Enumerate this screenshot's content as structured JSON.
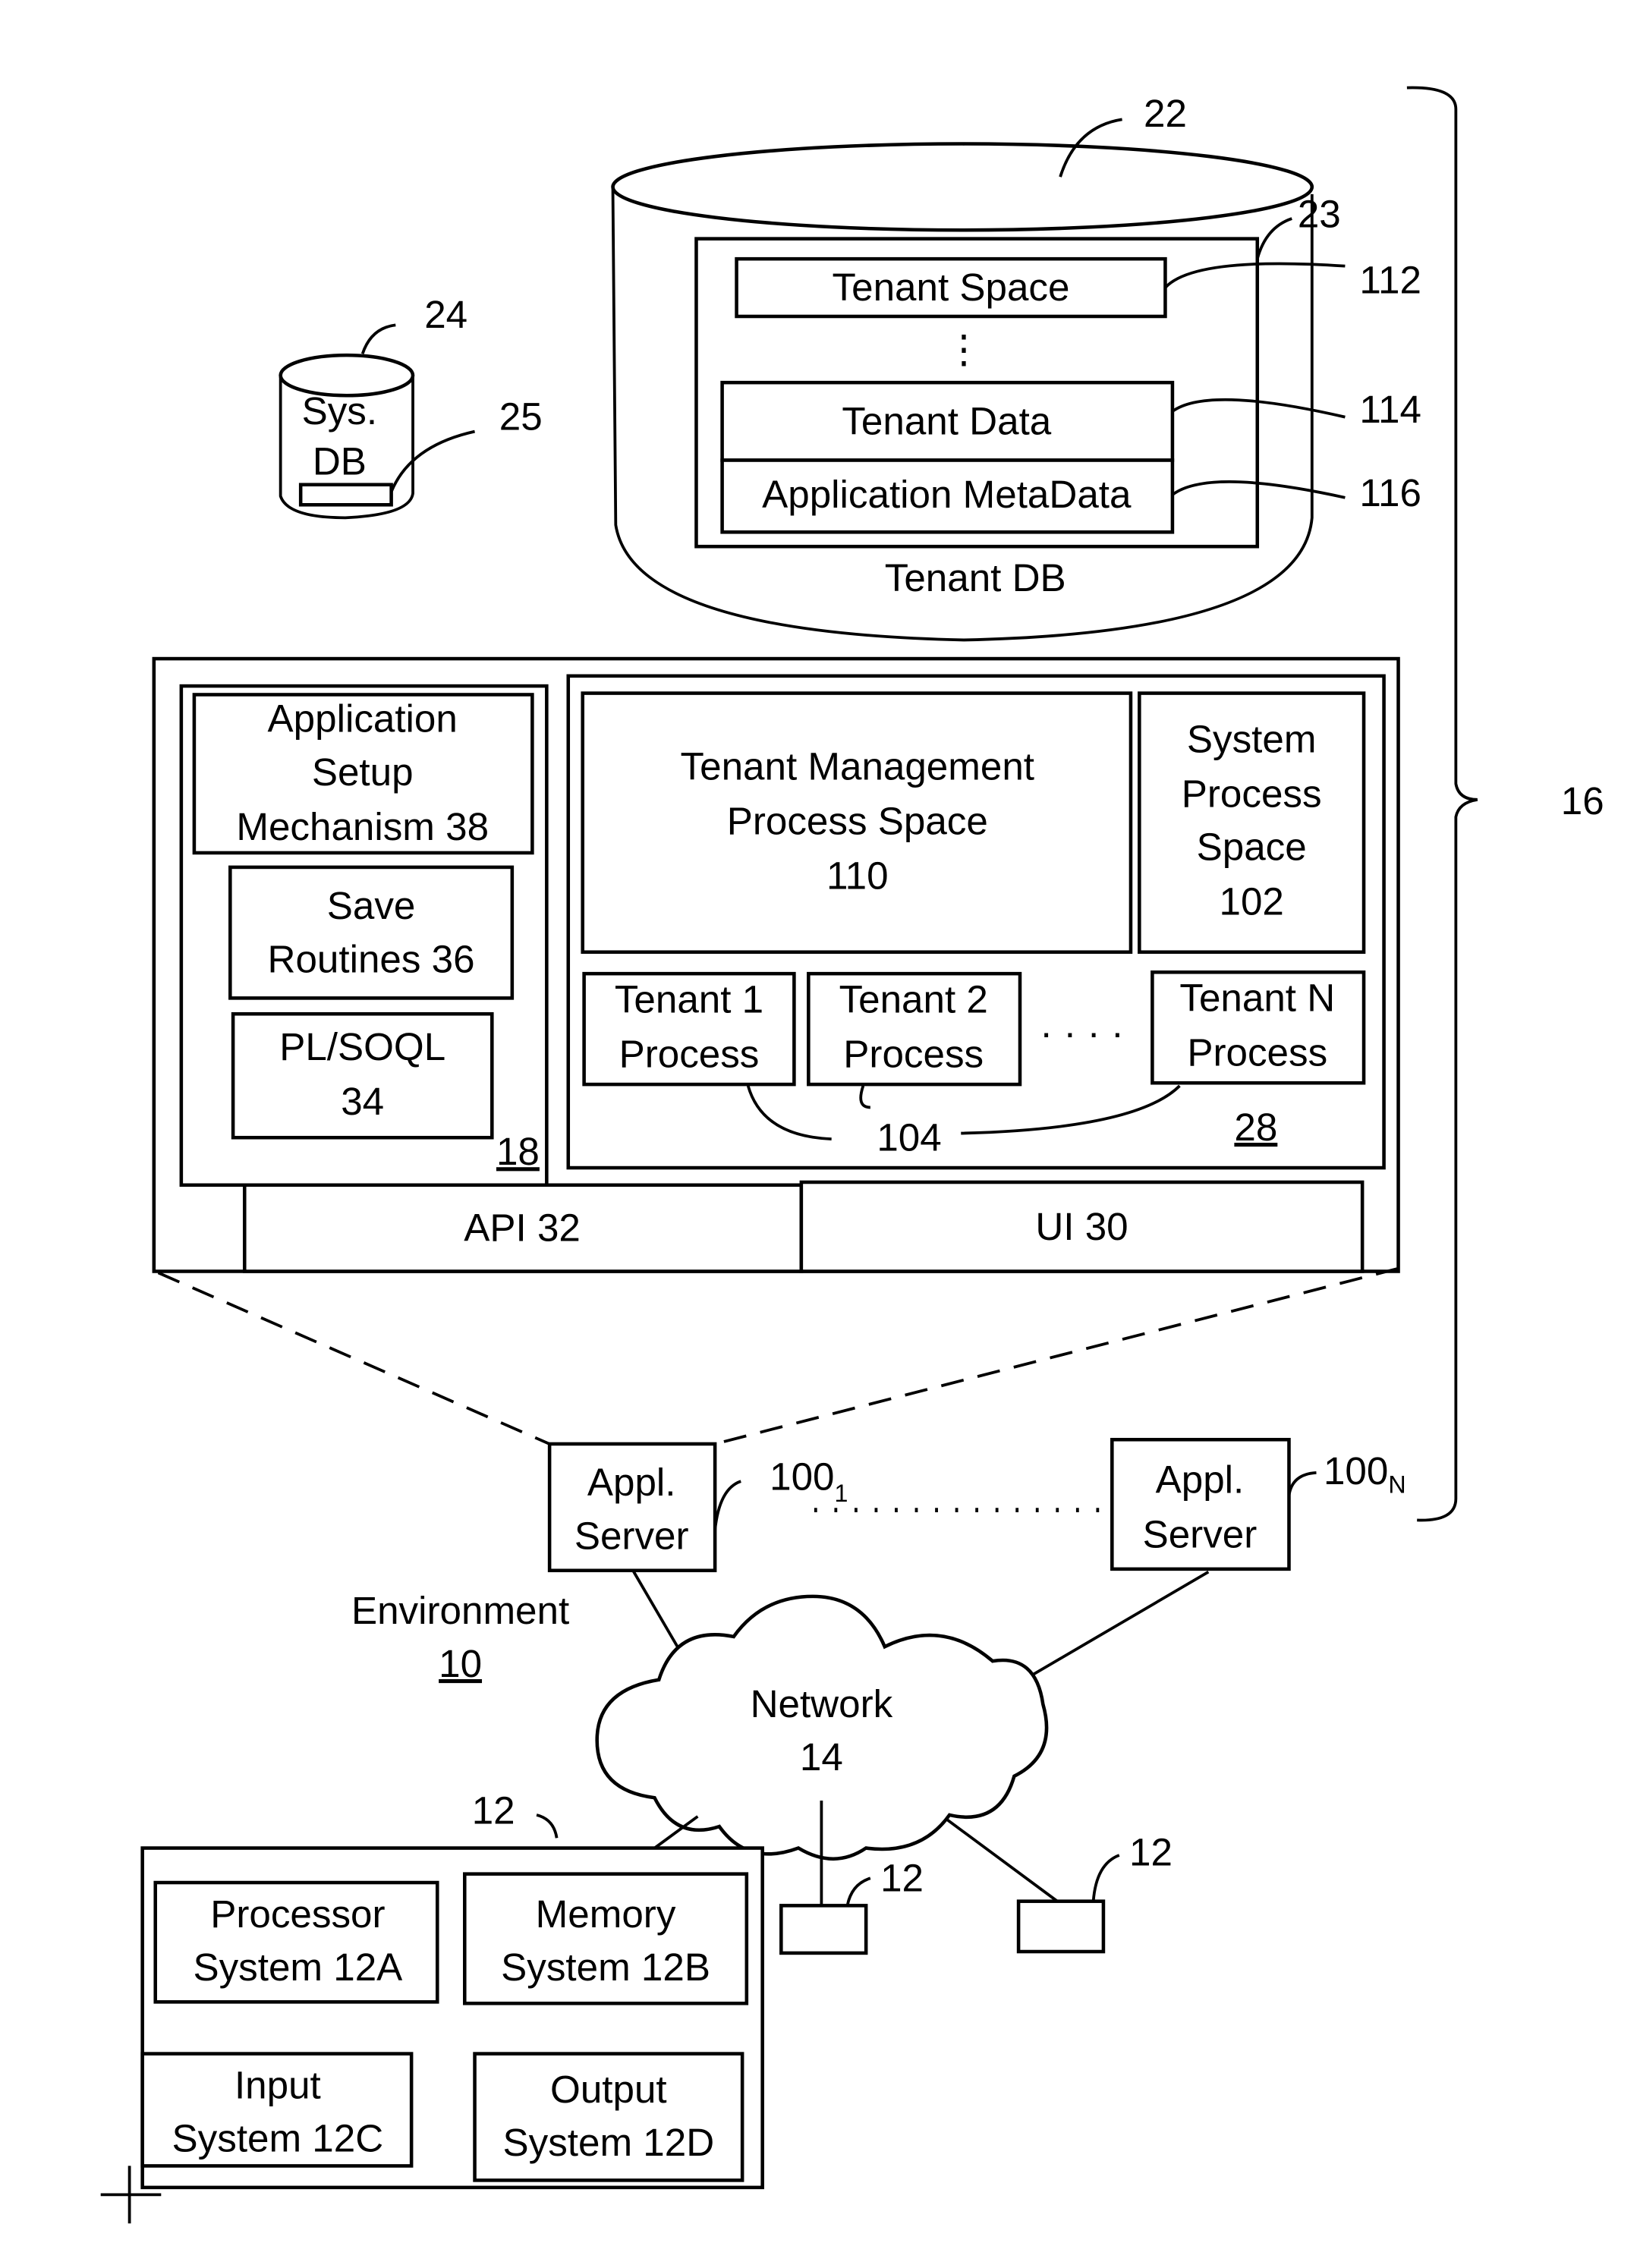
{
  "figure": {
    "tenant_db": {
      "ref": "22",
      "label": "Tenant DB",
      "container_ref": "23",
      "tenant_space": {
        "label": "Tenant Space",
        "ref": "112"
      },
      "ellipsis": "⋮",
      "tenant_data": {
        "label": "Tenant Data",
        "ref": "114"
      },
      "app_metadata": {
        "label": "Application MetaData",
        "ref": "116"
      }
    },
    "system_db": {
      "ref": "24",
      "line1": "Sys.",
      "line2": "DB",
      "inner_ref": "25"
    },
    "system_ref": "16",
    "server_detail": {
      "left_panel": {
        "ref": "18",
        "app_setup": [
          "Application",
          "Setup",
          "Mechanism 38"
        ],
        "save_routines": [
          "Save",
          "Routines 36"
        ],
        "plsoql": [
          "PL/SOQL",
          "34"
        ]
      },
      "right_panel": {
        "ref": "28",
        "tenant_mgmt": [
          "Tenant Management",
          "Process Space",
          "110"
        ],
        "system_process": [
          "System",
          "Process",
          "Space",
          "102"
        ],
        "tenant1": [
          "Tenant 1",
          "Process"
        ],
        "tenant2": [
          "Tenant 2",
          "Process"
        ],
        "tenant_dots": "· · · ·",
        "tenantN": [
          "Tenant N",
          "Process"
        ],
        "tenant_process_ref": "104"
      },
      "api": "API 32",
      "ui": "UI 30"
    },
    "app_servers": [
      {
        "line1": "Appl.",
        "line2": "Server",
        "ref_base": "100",
        "ref_sub": "1"
      },
      {
        "line1": "Appl.",
        "line2": "Server",
        "ref_base": "100",
        "ref_sub": "N"
      }
    ],
    "environment": {
      "label": "Environment",
      "ref": "10"
    },
    "network": {
      "label": "Network",
      "ref": "14"
    },
    "user_system": {
      "ref": "12",
      "processor": [
        "Processor",
        "System 12A"
      ],
      "memory": [
        "Memory",
        "System 12B"
      ],
      "input": [
        "Input",
        "System 12C"
      ],
      "output": [
        "Output",
        "System 12D"
      ]
    },
    "user_terminals": [
      {
        "ref": "12"
      },
      {
        "ref": "12"
      }
    ]
  }
}
